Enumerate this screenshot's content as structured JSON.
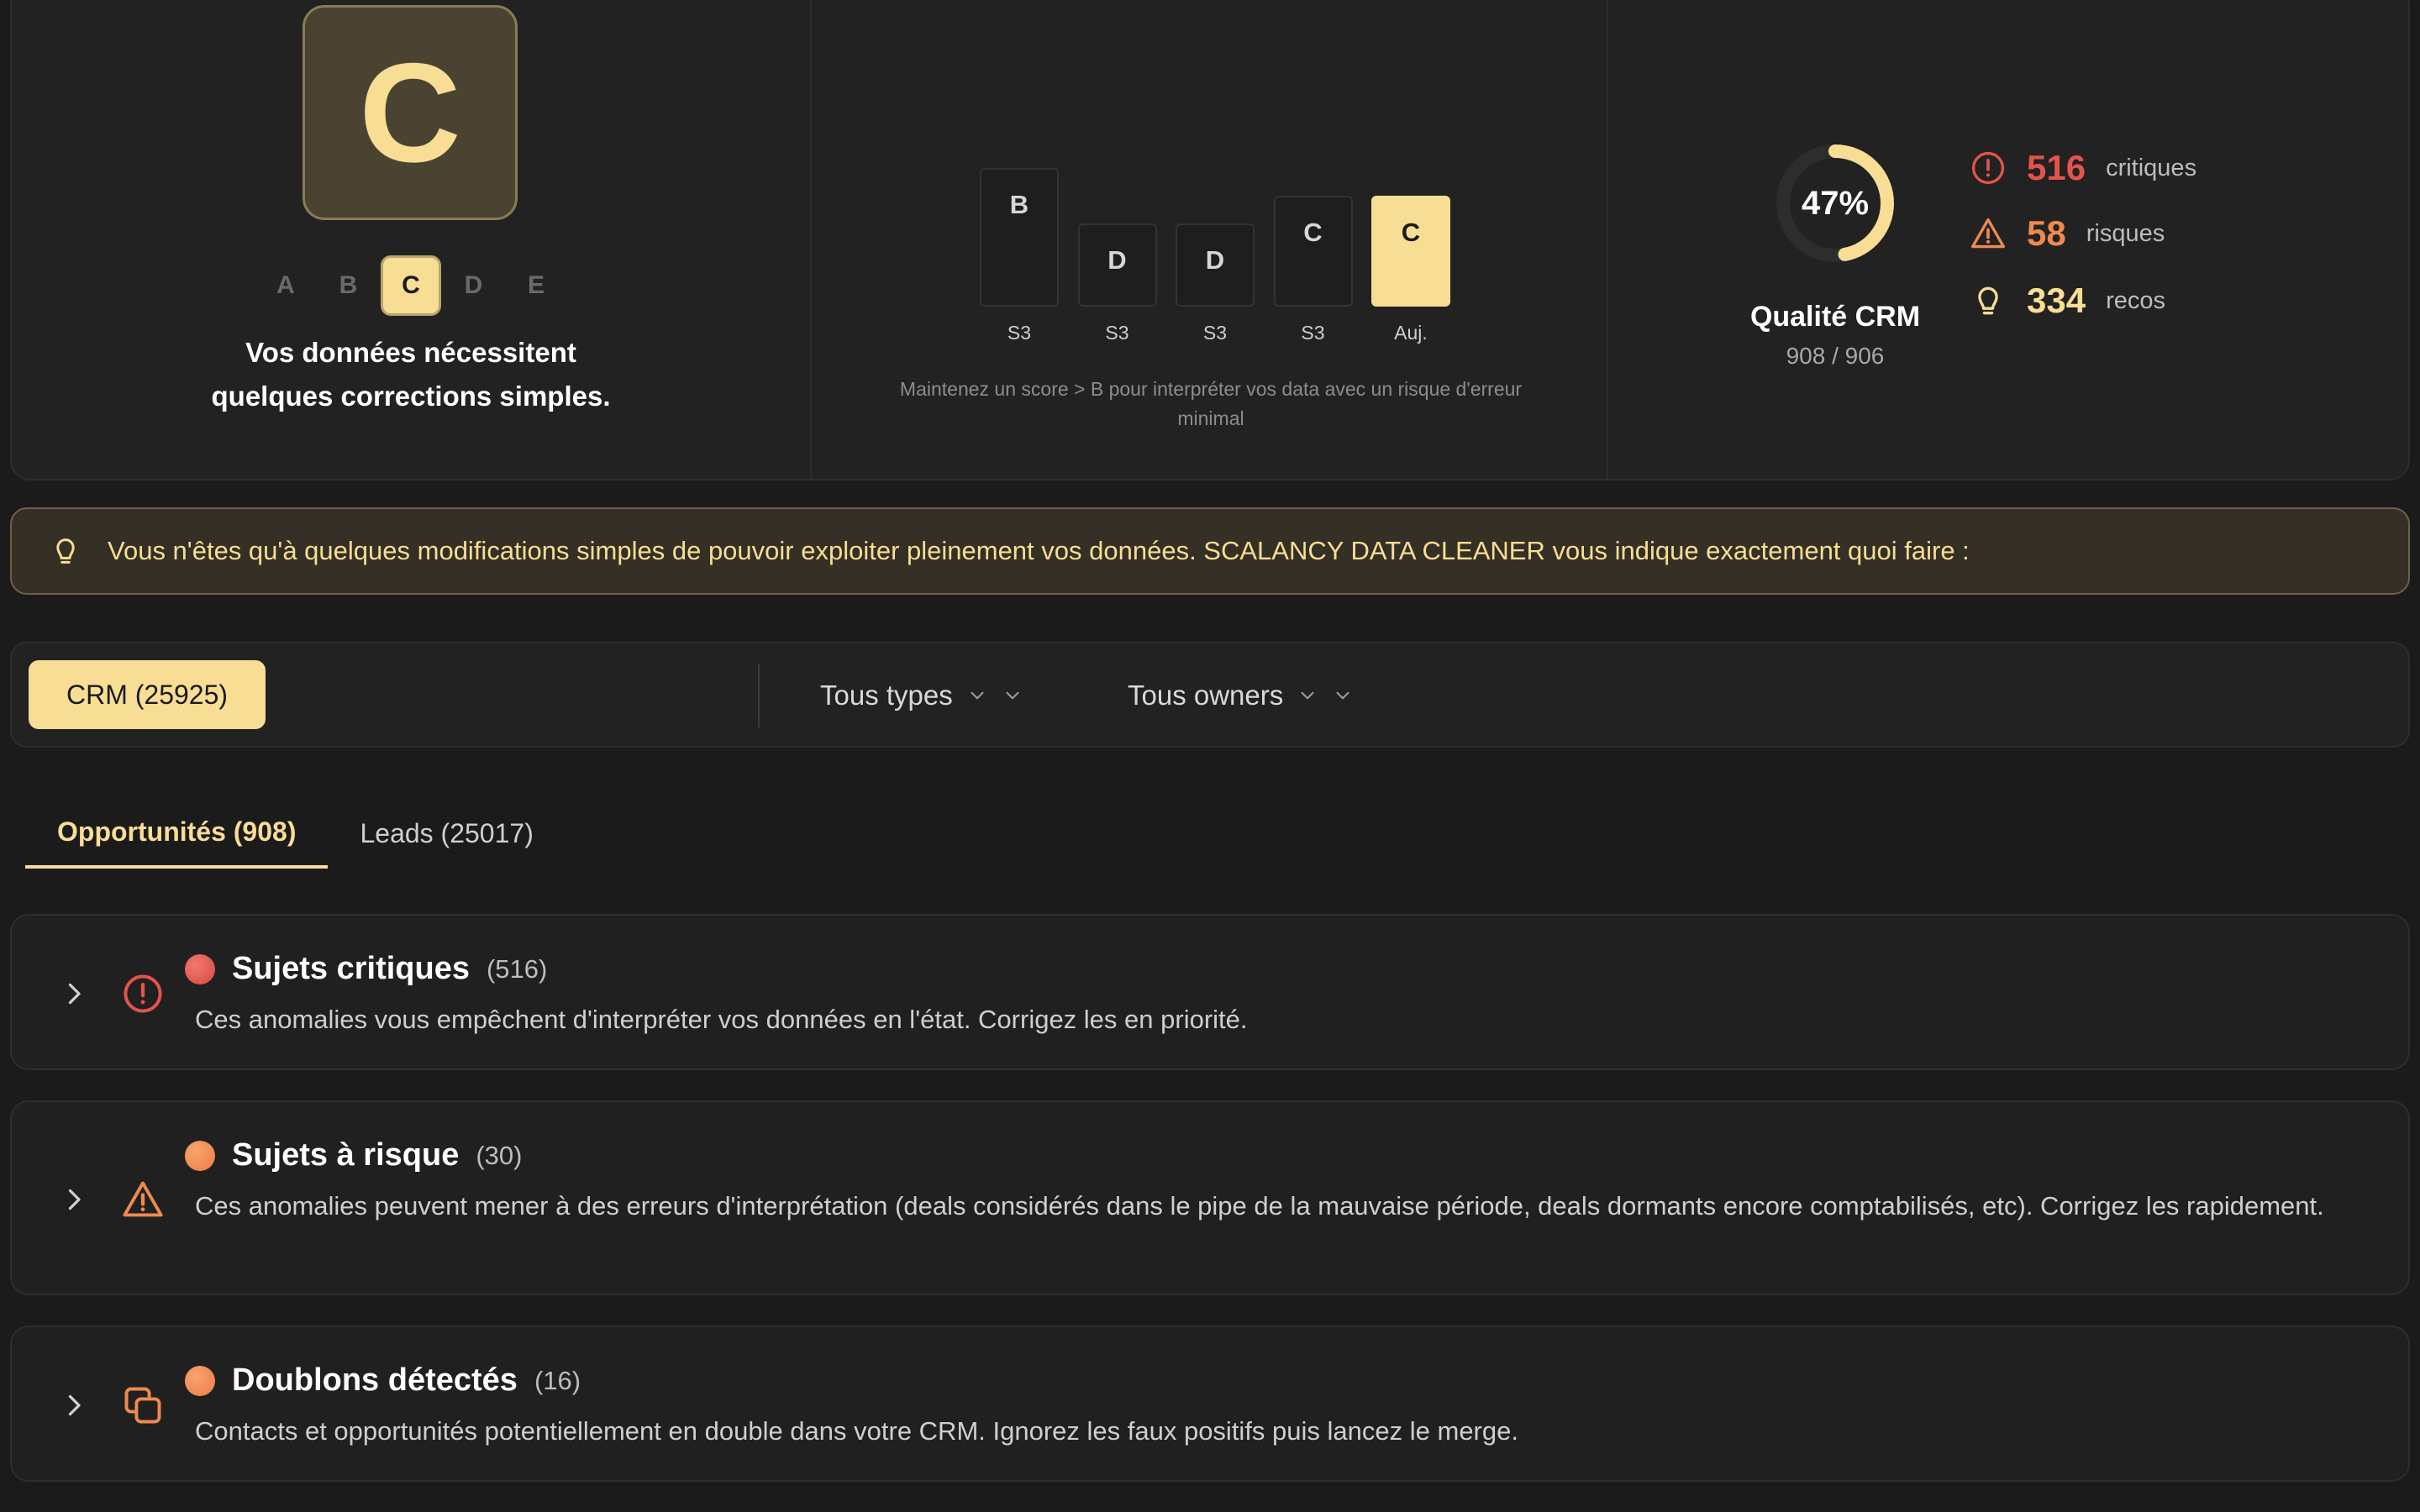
{
  "score": {
    "grade": "C",
    "scale": [
      "A",
      "B",
      "C",
      "D",
      "E"
    ],
    "active_grade": "C",
    "message_line1": "Vos données nécessitent",
    "message_line2": "quelques corrections simples."
  },
  "history": {
    "items": [
      {
        "grade": "B",
        "label": "S3",
        "level": 5
      },
      {
        "grade": "D",
        "label": "S3",
        "level": 3
      },
      {
        "grade": "D",
        "label": "S3",
        "level": 3
      },
      {
        "grade": "C",
        "label": "S3",
        "level": 4
      },
      {
        "grade": "C",
        "label": "Auj.",
        "level": 4,
        "current": true
      }
    ],
    "note": "Maintenez un score > B pour interpréter vos data avec un risque d'erreur minimal"
  },
  "quality": {
    "percent": 47,
    "percent_label": "47%",
    "label": "Qualité CRM",
    "count": "908 / 906",
    "stats": [
      {
        "value": "516",
        "label": "critiques",
        "color": "#e5534b",
        "icon": "alert-circle-icon"
      },
      {
        "value": "58",
        "label": "risques",
        "color": "#ee8a4f",
        "icon": "warning-triangle-icon"
      },
      {
        "value": "334",
        "label": "recos",
        "color": "#f8dd95",
        "icon": "lightbulb-icon"
      }
    ]
  },
  "banner": {
    "text": "Vous n'êtes qu'à quelques modifications simples de pouvoir exploiter pleinement vos données. SCALANCY DATA CLEANER vous indique exactement quoi faire :",
    "icon": "lightbulb-icon"
  },
  "filters": {
    "crm_button": "CRM (25925)",
    "type_select": "Tous types",
    "owner_select": "Tous owners"
  },
  "tabs": [
    {
      "label": "Opportunités (908)",
      "active": true
    },
    {
      "label": "Leads (25017)",
      "active": false
    }
  ],
  "cards": [
    {
      "title": "Sujets critiques",
      "count": "(516)",
      "description": "Ces anomalies vous empêchent d'interpréter vos données en l'état. Corrigez les en priorité.",
      "icon": "alert-circle-icon",
      "dot_color": "#d9463f"
    },
    {
      "title": "Sujets à risque",
      "count": "(30)",
      "description": "Ces anomalies peuvent mener à des erreurs d'interprétation (deals considérés dans le pipe de la mauvaise période, deals dormants encore comptabilisés, etc). Corrigez les rapidement.",
      "icon": "warning-triangle-icon",
      "dot_color": "#ee7d45"
    },
    {
      "title": "Doublons détectés",
      "count": "(16)",
      "description": "Contacts et opportunités potentiellement en double dans votre CRM. Ignorez les faux positifs puis lancez le merge.",
      "icon": "duplicate-icon",
      "dot_color": "#ee7d45"
    }
  ],
  "colors": {
    "accent": "#f8dd95",
    "critical": "#e5534b",
    "risk": "#ee8a4f",
    "background": "#1b1b1b"
  }
}
